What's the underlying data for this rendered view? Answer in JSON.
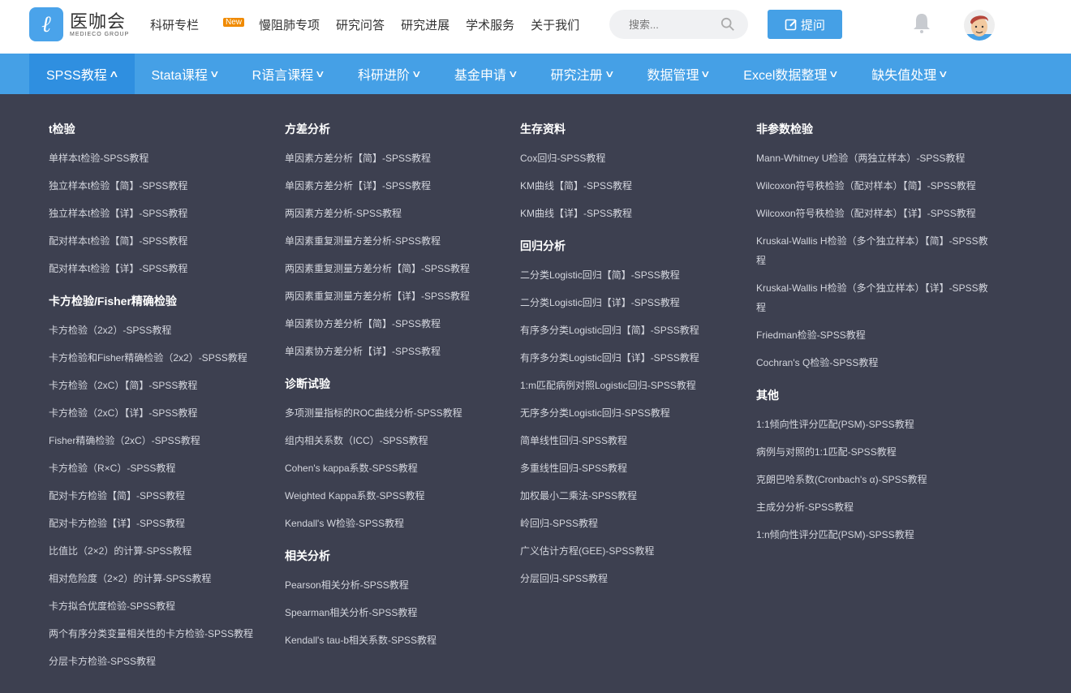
{
  "header": {
    "brand_cn": "医咖会",
    "brand_en": "MEDIECO GROUP",
    "nav": [
      "科研专栏",
      "慢阻肺专项",
      "研究问答",
      "研究进展",
      "学术服务",
      "关于我们"
    ],
    "new_badge": "New",
    "search_placeholder": "搜索...",
    "ask_label": "提问"
  },
  "nav": [
    {
      "label": "SPSS教程",
      "active": true
    },
    {
      "label": "Stata课程"
    },
    {
      "label": "R语言课程"
    },
    {
      "label": "科研进阶"
    },
    {
      "label": "基金申请"
    },
    {
      "label": "研究注册"
    },
    {
      "label": "数据管理"
    },
    {
      "label": "Excel数据整理"
    },
    {
      "label": "缺失值处理"
    }
  ],
  "colors": {
    "nav": "#45a0e6",
    "active": "#2f8fe0",
    "menu_bg": "#3d4050"
  },
  "columns": [
    [
      {
        "title": "t检验",
        "items": [
          "单样本t检验-SPSS教程",
          "独立样本t检验【简】-SPSS教程",
          "独立样本t检验【详】-SPSS教程",
          "配对样本t检验【简】-SPSS教程",
          "配对样本t检验【详】-SPSS教程"
        ]
      },
      {
        "title": "卡方检验/Fisher精确检验",
        "items": [
          "卡方检验（2x2）-SPSS教程",
          "卡方检验和Fisher精确检验（2x2）-SPSS教程",
          "卡方检验（2xC）【简】-SPSS教程",
          "卡方检验（2xC）【详】-SPSS教程",
          "Fisher精确检验（2xC）-SPSS教程",
          "卡方检验（R×C）-SPSS教程",
          "配对卡方检验【简】-SPSS教程",
          "配对卡方检验【详】-SPSS教程",
          "比值比（2×2）的计算-SPSS教程",
          "相对危险度（2×2）的计算-SPSS教程",
          "卡方拟合优度检验-SPSS教程",
          "两个有序分类变量相关性的卡方检验-SPSS教程",
          "分层卡方检验-SPSS教程"
        ]
      }
    ],
    [
      {
        "title": "方差分析",
        "items": [
          "单因素方差分析【简】-SPSS教程",
          "单因素方差分析【详】-SPSS教程",
          "两因素方差分析-SPSS教程",
          "单因素重复测量方差分析-SPSS教程",
          "两因素重复测量方差分析【简】-SPSS教程",
          "两因素重复测量方差分析【详】-SPSS教程",
          "单因素协方差分析【简】-SPSS教程",
          "单因素协方差分析【详】-SPSS教程"
        ]
      },
      {
        "title": "诊断试验",
        "items": [
          "多项测量指标的ROC曲线分析-SPSS教程",
          "组内相关系数（ICC）-SPSS教程",
          "Cohen's kappa系数-SPSS教程",
          "Weighted Kappa系数-SPSS教程",
          "Kendall's W检验-SPSS教程"
        ]
      },
      {
        "title": "相关分析",
        "items": [
          "Pearson相关分析-SPSS教程",
          "Spearman相关分析-SPSS教程",
          "Kendall's tau-b相关系数-SPSS教程"
        ]
      }
    ],
    [
      {
        "title": "生存资料",
        "items": [
          "Cox回归-SPSS教程",
          "KM曲线【简】-SPSS教程",
          "KM曲线【详】-SPSS教程"
        ]
      },
      {
        "title": "回归分析",
        "items": [
          "二分类Logistic回归【简】-SPSS教程",
          "二分类Logistic回归【详】-SPSS教程",
          "有序多分类Logistic回归【简】-SPSS教程",
          "有序多分类Logistic回归【详】-SPSS教程",
          "1:m匹配病例对照Logistic回归-SPSS教程",
          "无序多分类Logistic回归-SPSS教程",
          "简单线性回归-SPSS教程",
          "多重线性回归-SPSS教程",
          "加权最小二乘法-SPSS教程",
          "岭回归-SPSS教程",
          "广义估计方程(GEE)-SPSS教程",
          "分层回归-SPSS教程"
        ]
      }
    ],
    [
      {
        "title": "非参数检验",
        "items": [
          "Mann-Whitney U检验（两独立样本）-SPSS教程",
          "Wilcoxon符号秩检验（配对样本）【简】-SPSS教程",
          "Wilcoxon符号秩检验（配对样本）【详】-SPSS教程",
          "Kruskal-Wallis H检验（多个独立样本）【简】-SPSS教程",
          "Kruskal-Wallis H检验（多个独立样本）【详】-SPSS教程",
          "Friedman检验-SPSS教程",
          "Cochran's Q检验-SPSS教程"
        ]
      },
      {
        "title": "其他",
        "items": [
          "1:1倾向性评分匹配(PSM)-SPSS教程",
          "病例与对照的1:1匹配-SPSS教程",
          "克朗巴哈系数(Cronbach's α)-SPSS教程",
          "主成分分析-SPSS教程",
          "1:n倾向性评分匹配(PSM)-SPSS教程"
        ]
      }
    ]
  ]
}
